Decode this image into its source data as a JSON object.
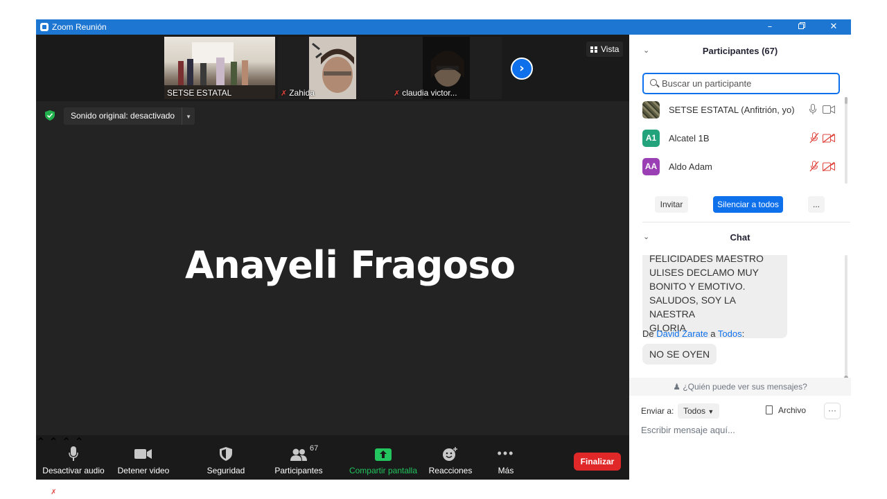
{
  "window": {
    "title": "Zoom Reunión",
    "controls": [
      "minimize",
      "restore",
      "close"
    ]
  },
  "strip": {
    "thumbnails": [
      {
        "name": "SETSE ESTATAL",
        "muted": false
      },
      {
        "name": "Zahida",
        "muted": true
      },
      {
        "name": "claudia victor...",
        "muted": true
      }
    ],
    "view_label": "Vista"
  },
  "main": {
    "sound_label": "Sonido original: desactivado",
    "speaker_name": "Anayeli Fragoso"
  },
  "toolbar": {
    "audio": "Desactivar audio",
    "video": "Detener video",
    "security": "Seguridad",
    "participants": "Participantes",
    "participant_count": "67",
    "share": "Compartir pantalla",
    "reactions": "Reacciones",
    "more": "Más",
    "end": "Finalizar"
  },
  "participants_panel": {
    "title": "Participantes (67)",
    "search_placeholder": "Buscar un participante",
    "list": [
      {
        "initials": "",
        "name": "SETSE ESTATAL (Anfitrión, yo)",
        "color": "#6b6b4e",
        "mic": "on",
        "video": "on"
      },
      {
        "initials": "A1",
        "name": "Alcatel 1B",
        "color": "#23a37b",
        "mic": "muted",
        "video": "off"
      },
      {
        "initials": "AA",
        "name": "Aldo Adam",
        "color": "#9b3fb5",
        "mic": "muted",
        "video": "off"
      }
    ],
    "invite": "Invitar",
    "mute_all": "Silenciar a todos",
    "more": "..."
  },
  "chat": {
    "title": "Chat",
    "messages": [
      {
        "from": "",
        "to": "",
        "text_lines": [
          "FELICIDADES MAESTRO",
          "ULISES DECLAMO MUY",
          "BONITO Y EMOTIVO.",
          "SALUDOS, SOY LA NAESTRA",
          "GLORIA"
        ]
      },
      {
        "prefix": "De",
        "from": "David Zarate",
        "sep": "a",
        "to": "Todos",
        "colon": ":",
        "text": "NO SE OYEN"
      }
    ],
    "who_can_see": "¿Quién puede ver sus mensajes?",
    "send_to_label": "Enviar a:",
    "send_to_value": "Todos",
    "file_label": "Archivo",
    "more": "···",
    "compose_placeholder": "Escribir mensaje aquí..."
  },
  "colors": {
    "titlebar": "#1d76d2",
    "accent": "#0e71eb",
    "end": "#e02828",
    "share": "#22c55e",
    "muted": "#e0443e"
  }
}
